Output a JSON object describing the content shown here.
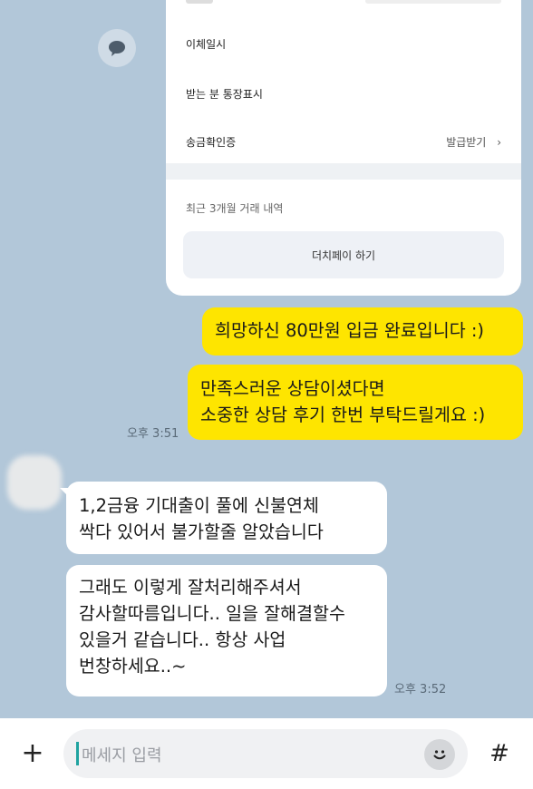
{
  "transfer_card": {
    "rows": [
      {
        "label": "이체일시"
      },
      {
        "label": "받는 분 통장표시"
      },
      {
        "label": "송금확인증",
        "value": "발급받기"
      }
    ],
    "recent_label": "최근 3개월 거래 내역",
    "dutch_button": "더치페이 하기"
  },
  "messages": [
    {
      "side": "me",
      "text": "희망하신 80만원 입금 완료입니다 :)"
    },
    {
      "side": "me",
      "text": "만족스러운 상담이셨다면\n소중한 상담 후기 한번 부탁드릴게요 :)",
      "time": "오후 3:51"
    },
    {
      "side": "other",
      "text": "1,2금융 기대출이 풀에 신불연체\n싹다 있어서 불가할줄 알았습니다"
    },
    {
      "side": "other",
      "text": "그래도 이렇게 잘처리해주셔서\n감사할따름입니다.. 일을 잘해결할수\n있을거 같습니다.. 항상 사업\n번창하세요..~",
      "time": "오후 3:52"
    }
  ],
  "input_bar": {
    "placeholder": "메세지 입력",
    "plus_symbol": "+",
    "hash_symbol": "#"
  }
}
